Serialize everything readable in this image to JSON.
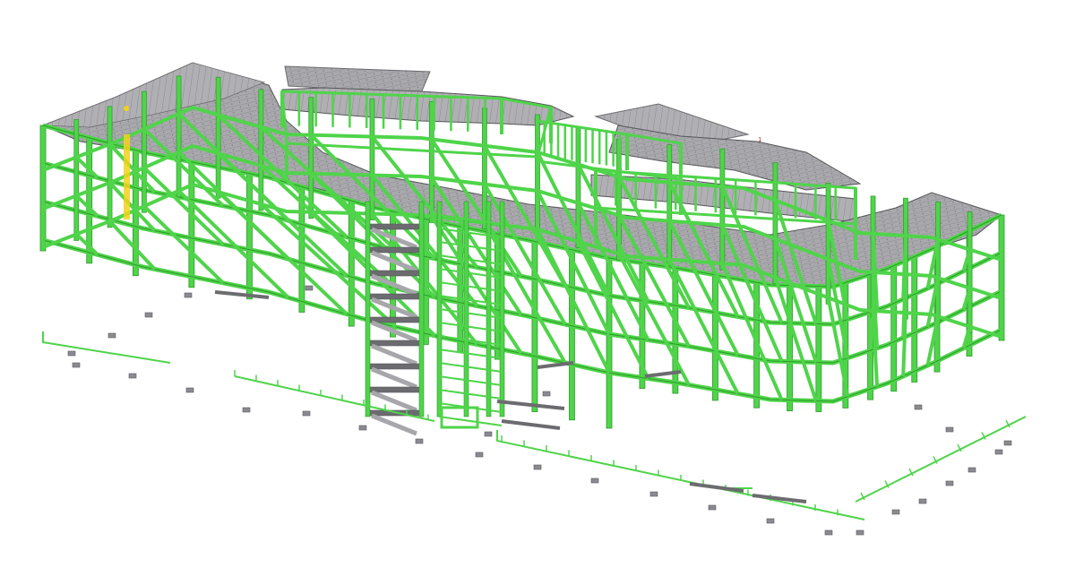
{
  "scene": {
    "colors": {
      "background": "#ffffff",
      "steel": "#4fd44a",
      "steel_dark": "#2e9a2b",
      "steel_light": "#7ef07a",
      "deck": "#a7a7ab",
      "deck_dark": "#6c6c70",
      "deck_edge": "#55555a",
      "marker": "#f2d21b",
      "tag": "#c0392b"
    },
    "labels": {
      "grid_tag": "1"
    }
  }
}
